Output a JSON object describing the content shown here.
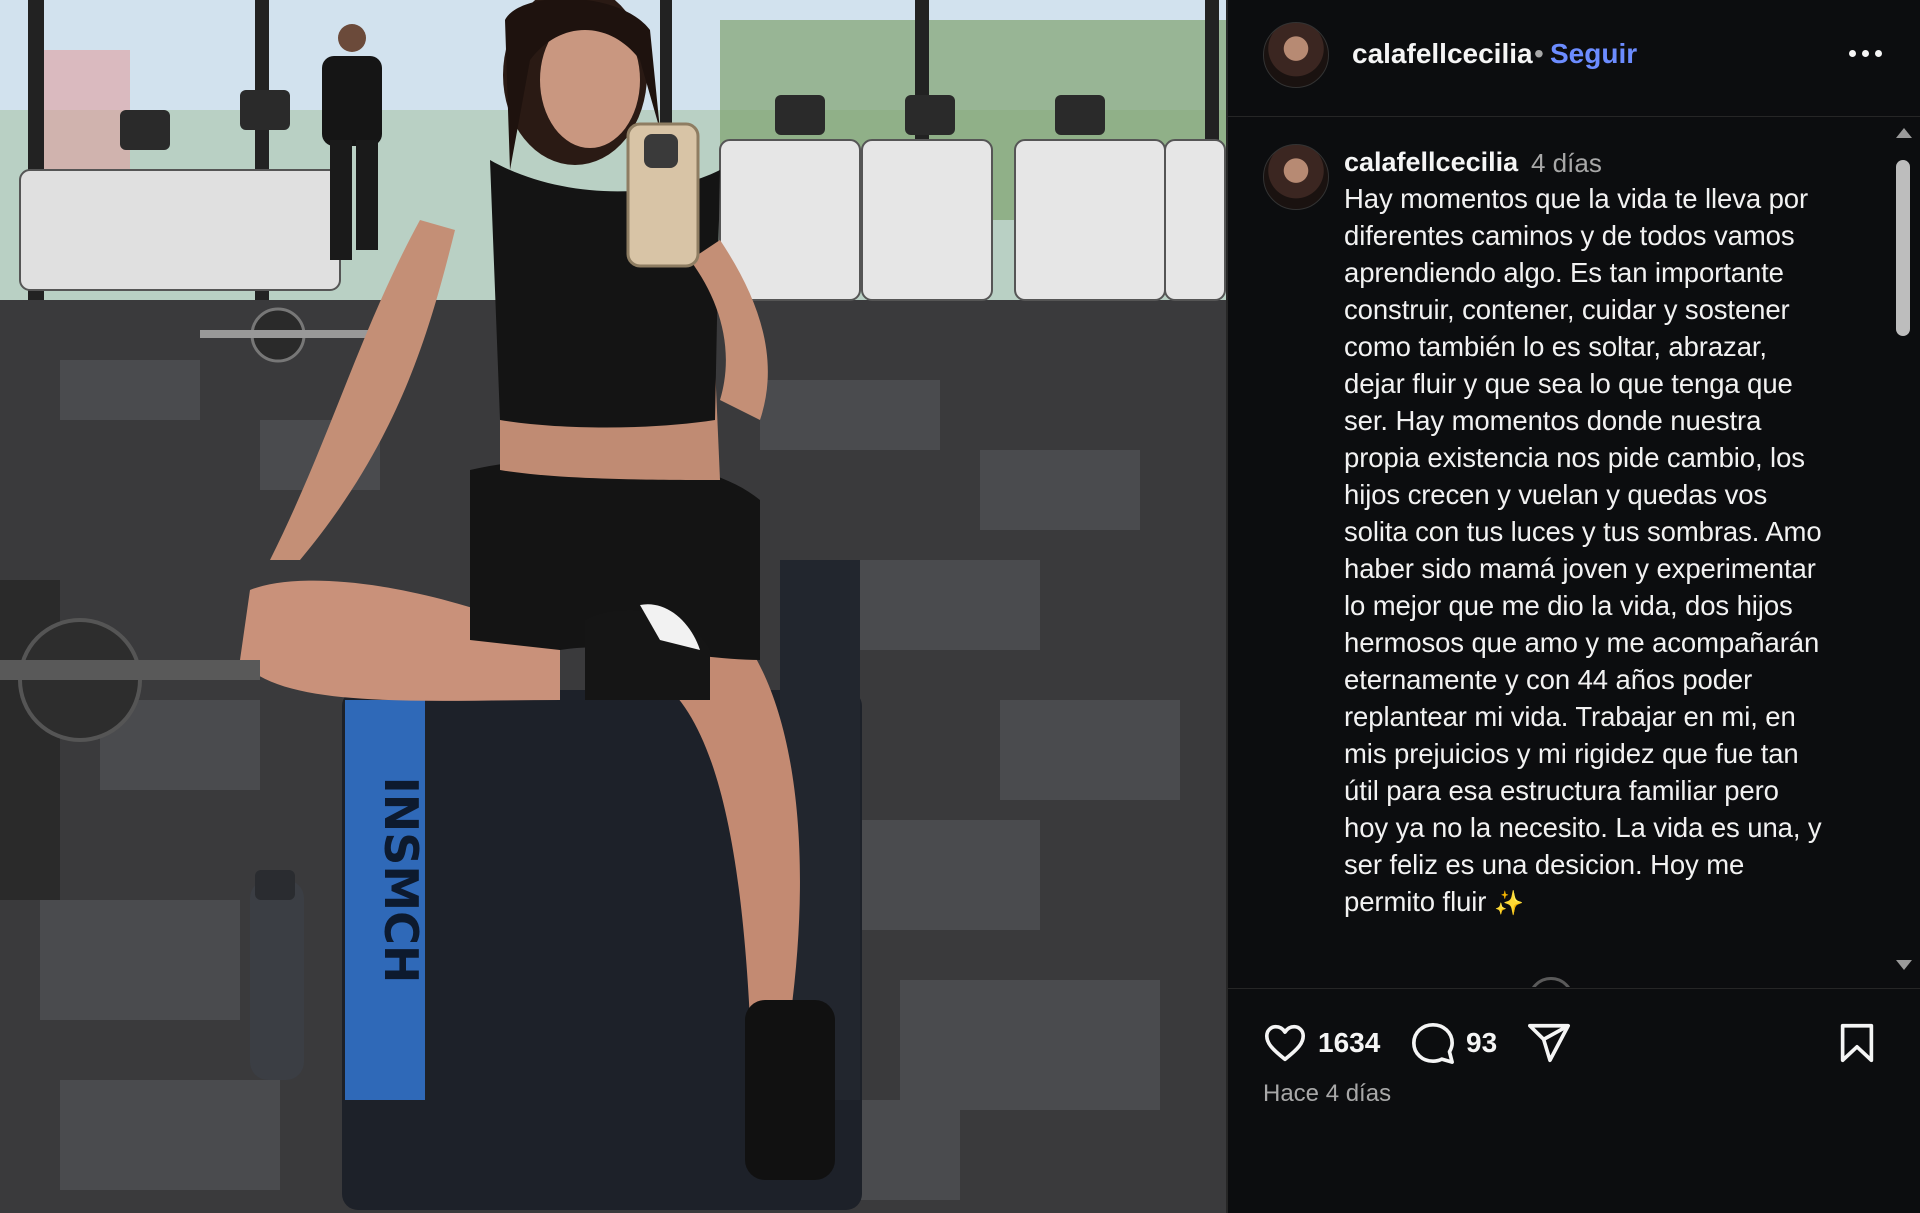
{
  "post": {
    "username": "calafellcecilia",
    "separator": "•",
    "follow_label": "Seguir",
    "more_icon": "more-horizontal-icon"
  },
  "caption": {
    "username": "calafellcecilia",
    "time_ago": "4 días",
    "text": "Hay momentos que la vida te lleva por\ndiferentes caminos y de todos vamos\naprendiendo algo. Es tan importante\nconstruir, contener, cuidar y sostener\ncomo también lo es soltar, abrazar,\ndejar fluir y que sea lo que tenga que\nser. Hay momentos donde nuestra\npropia existencia nos pide cambio, los\nhijos crecen y vuelan y quedas vos\nsolita con tus luces y tus sombras.  Amo\nhaber sido mamá joven y experimentar\nlo mejor que me dio la vida, dos hijos\nhermosos que amo y me acompañarán\neternamente y con 44 años poder\nreplantear mi vida. Trabajar en mi, en\nmis prejuicios y mi rigidez que fue tan\nútil para esa estructura familiar pero\nhoy ya no la necesito. La vida es una, y\nser feliz es una desicion. Hoy me\npermito fluir",
    "emoji": "✨"
  },
  "actions": {
    "likes": "1634",
    "comments": "93"
  },
  "footer": {
    "timestamp": "Hace 4 días"
  },
  "photo": {
    "box_print": "INSMCH"
  },
  "colors": {
    "panel_bg": "#0c0d0f",
    "link_blue": "#6c8cff",
    "muted": "#a8a8a8"
  }
}
